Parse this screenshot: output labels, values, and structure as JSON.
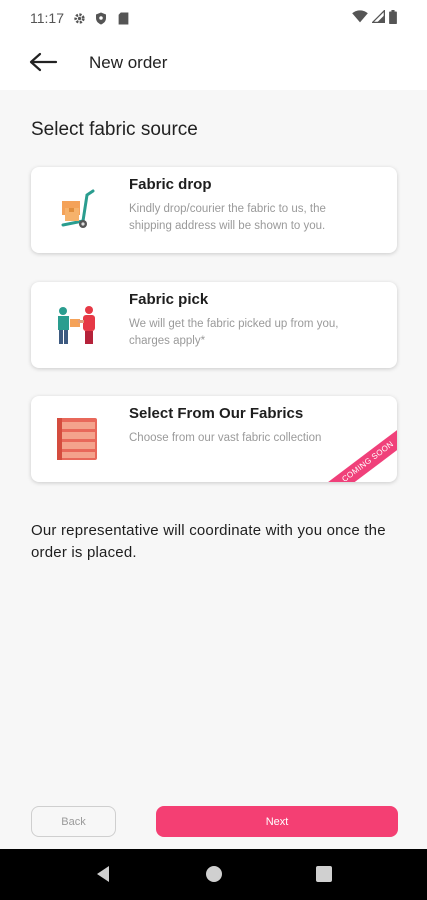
{
  "status_bar": {
    "time": "11:17",
    "icons": [
      "gear-icon",
      "shield-icon",
      "sim-card-icon"
    ],
    "right_icons": [
      "wifi-icon",
      "signal-icon",
      "battery-icon"
    ]
  },
  "app_bar": {
    "title": "New order",
    "back_icon": "arrow-left-icon"
  },
  "page": {
    "section_title": "Select fabric source",
    "options": [
      {
        "title": "Fabric drop",
        "description": "Kindly drop/courier the fabric to us, the shipping address will be shown to you.",
        "icon": "hand-truck-boxes-icon"
      },
      {
        "title": "Fabric pick",
        "description": "We will get the fabric picked up from you, charges apply*",
        "icon": "delivery-handover-icon"
      },
      {
        "title": "Select From Our Fabrics",
        "description": "Choose from our vast fabric collection",
        "icon": "fabric-shelf-icon",
        "badge": "COMING SOON"
      }
    ],
    "note": "Our representative will coordinate with you once the order is placed."
  },
  "footer": {
    "back_label": "Back",
    "next_label": "Next"
  },
  "colors": {
    "accent": "#f43f73",
    "background": "#f7f7f7",
    "card": "#ffffff",
    "nav_bar": "#000000"
  }
}
